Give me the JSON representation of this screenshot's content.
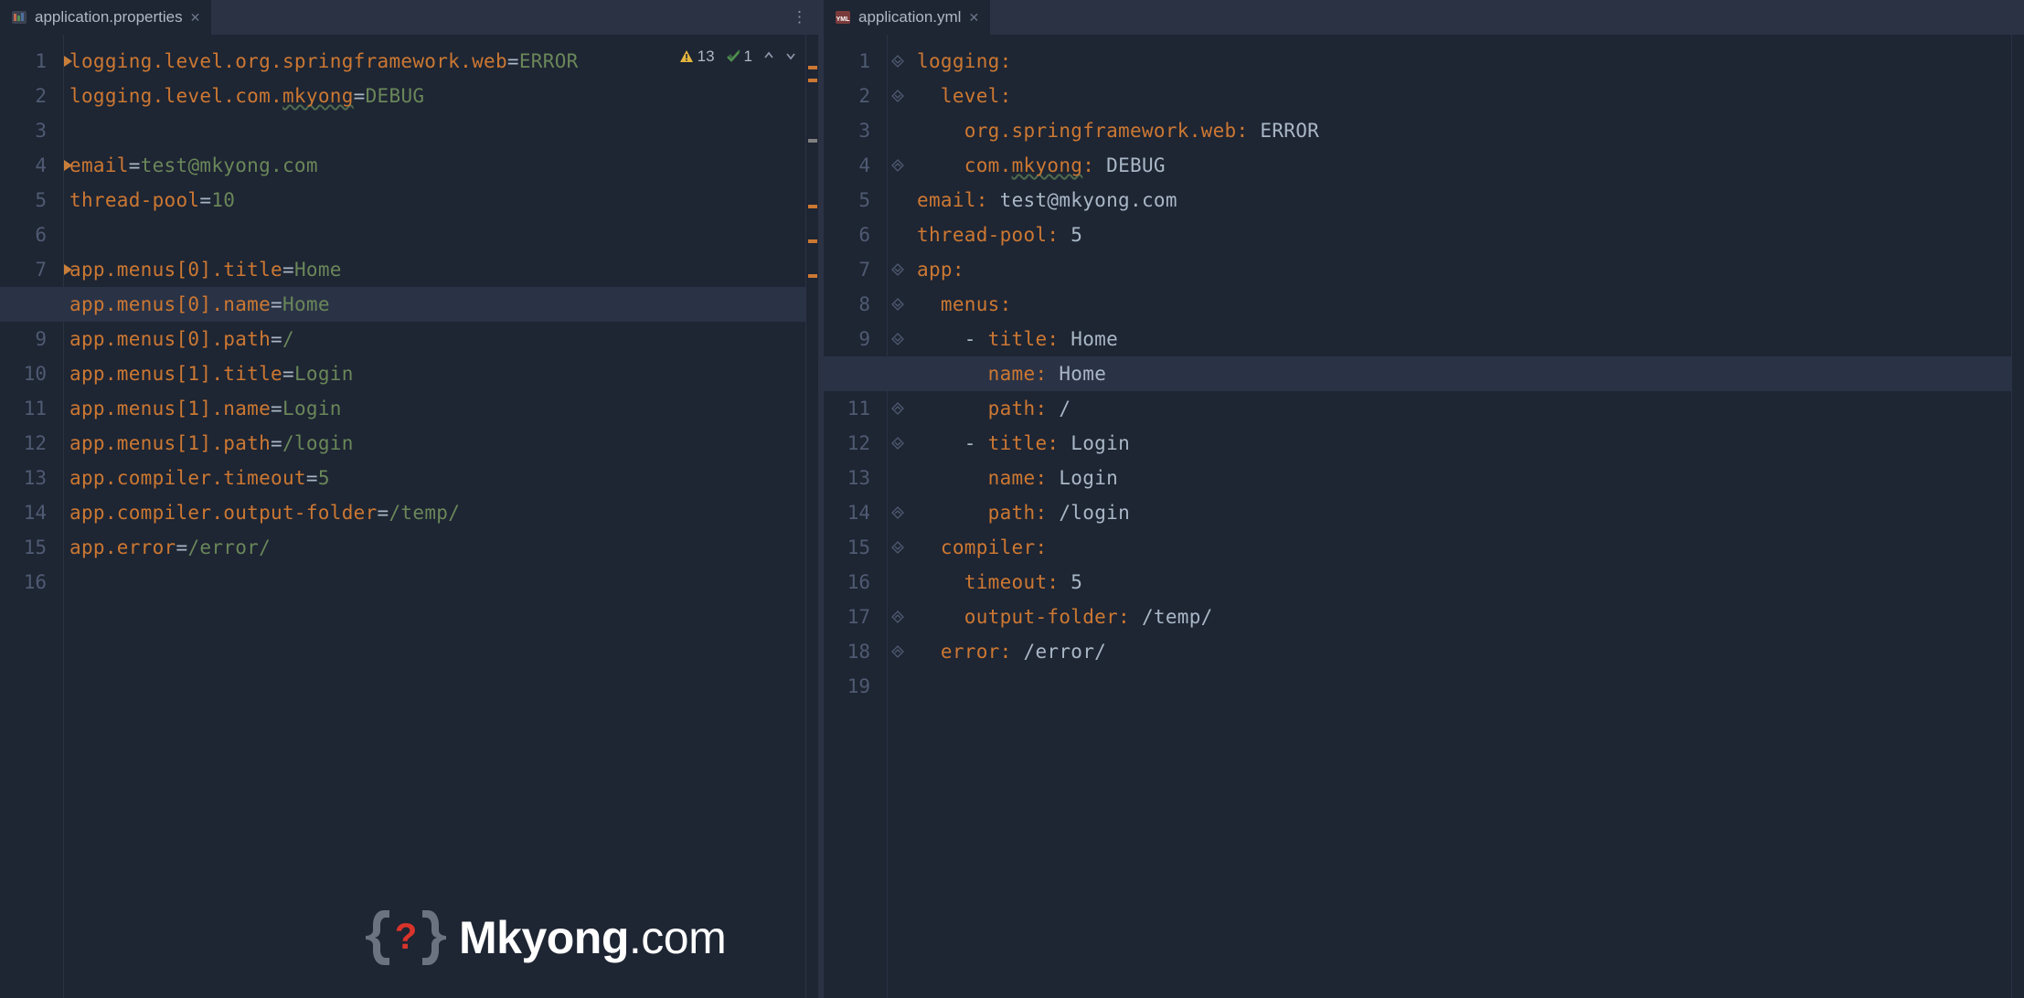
{
  "left": {
    "tab": {
      "filename": "application.properties"
    },
    "inspections": {
      "warnings": "13",
      "passes": "1"
    },
    "lines": 16,
    "active_line": 8,
    "bookmarks": [
      1,
      4,
      7
    ],
    "code": {
      "l1": {
        "key": "logging.level.org.springframework.web",
        "val": "ERROR"
      },
      "l2": {
        "key_a": "logging.level.com.",
        "key_typo": "mkyong",
        "val": "DEBUG"
      },
      "l4": {
        "key": "email",
        "val": "test@mkyong.com"
      },
      "l5": {
        "key": "thread-pool",
        "val": "10"
      },
      "l7": {
        "key": "app.menus[0].title",
        "val": "Home"
      },
      "l8": {
        "key": "app.menus[0].name",
        "val": "Home"
      },
      "l9": {
        "key": "app.menus[0].path",
        "val": "/"
      },
      "l10": {
        "key": "app.menus[1].title",
        "val": "Login"
      },
      "l11": {
        "key": "app.menus[1].name",
        "val": "Login"
      },
      "l12": {
        "key": "app.menus[1].path",
        "val": "/login"
      },
      "l13": {
        "key": "app.compiler.timeout",
        "val": "5"
      },
      "l14": {
        "key": "app.compiler.output-folder",
        "val": "/temp/"
      },
      "l15": {
        "key": "app.error",
        "val": "/error/"
      }
    }
  },
  "right": {
    "tab": {
      "filename": "application.yml"
    },
    "lines": 19,
    "active_line": 10,
    "code": {
      "l1": {
        "ind": 0,
        "key": "logging",
        "colon": true
      },
      "l2": {
        "ind": 1,
        "key": "level",
        "colon": true
      },
      "l3": {
        "ind": 2,
        "key": "org.springframework.web",
        "val": "ERROR"
      },
      "l4": {
        "ind": 2,
        "key_a": "com.",
        "key_typo": "mkyong",
        "val": "DEBUG"
      },
      "l5": {
        "ind": 0,
        "key": "email",
        "val": "test@mkyong.com"
      },
      "l6": {
        "ind": 0,
        "key": "thread-pool",
        "val": "5"
      },
      "l7": {
        "ind": 0,
        "key": "app",
        "colon": true
      },
      "l8": {
        "ind": 1,
        "key": "menus",
        "colon": true
      },
      "l9": {
        "ind": 2,
        "dash": true,
        "key": "title",
        "val": "Home"
      },
      "l10": {
        "ind": 3,
        "key": "name",
        "val": "Home"
      },
      "l11": {
        "ind": 3,
        "key": "path",
        "val": "/"
      },
      "l12": {
        "ind": 2,
        "dash": true,
        "key": "title",
        "val": "Login"
      },
      "l13": {
        "ind": 3,
        "key": "name",
        "val": "Login"
      },
      "l14": {
        "ind": 3,
        "key": "path",
        "val": "/login"
      },
      "l15": {
        "ind": 1,
        "key": "compiler",
        "colon": true
      },
      "l16": {
        "ind": 2,
        "key": "timeout",
        "val": "5"
      },
      "l17": {
        "ind": 2,
        "key": "output-folder",
        "val": "/temp/"
      },
      "l18": {
        "ind": 1,
        "key": "error",
        "val": "/error/"
      }
    }
  },
  "watermark": {
    "brand_main": "Mkyong",
    "brand_suffix": ".com"
  }
}
